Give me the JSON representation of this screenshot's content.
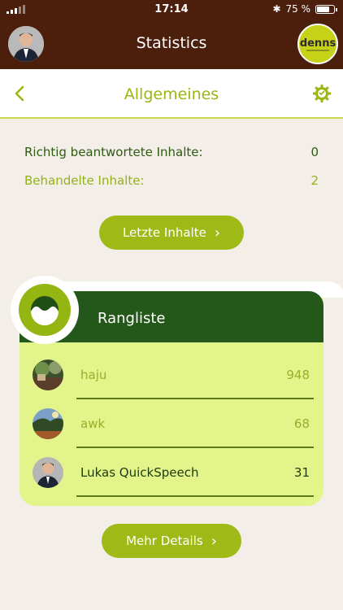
{
  "status_bar": {
    "time": "17:14",
    "battery_percent": "75 %"
  },
  "header": {
    "title": "Statistics",
    "brand": "denns"
  },
  "section": {
    "title": "Allgemeines",
    "back_icon": "chevron-left-icon",
    "settings_icon": "gear-icon"
  },
  "stats": [
    {
      "label": "Richtig beantwortete Inhalte:",
      "value": "0"
    },
    {
      "label": "Behandelte Inhalte:",
      "value": "2"
    }
  ],
  "buttons": {
    "last_contents": "Letzte Inhalte",
    "more_details": "Mehr Details"
  },
  "ranking": {
    "title": "Rangliste",
    "items": [
      {
        "name": "haju",
        "score": "948"
      },
      {
        "name": "awk",
        "score": "68"
      },
      {
        "name": "Lukas QuickSpeech",
        "score": "31"
      }
    ]
  },
  "colors": {
    "header_bg": "#4c1e0c",
    "accent": "#9fb917",
    "card_bg": "#e3f48b",
    "rank_header": "#23581a"
  }
}
